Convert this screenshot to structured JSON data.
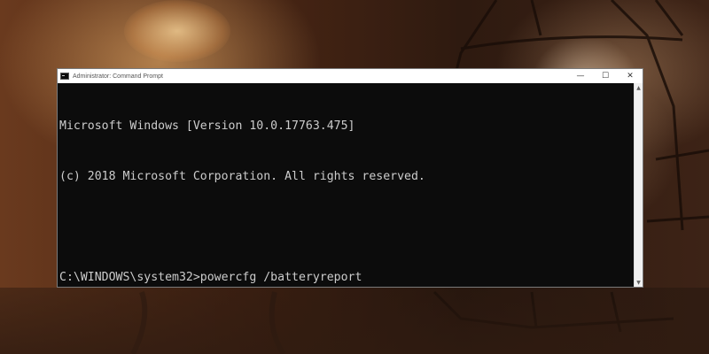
{
  "window": {
    "title": "Administrator: Command Prompt",
    "icon": "cmd-icon",
    "controls": {
      "minimize_glyph": "—",
      "maximize_glyph": "☐",
      "close_glyph": "✕"
    }
  },
  "console": {
    "lines": [
      "Microsoft Windows [Version 10.0.17763.475]",
      "(c) 2018 Microsoft Corporation. All rights reserved.",
      "",
      "C:\\WINDOWS\\system32>powercfg /batteryreport"
    ],
    "text_color": "#cccccc",
    "background_color": "#0c0c0c"
  },
  "scrollbar": {
    "up_glyph": "▲",
    "down_glyph": "▼"
  }
}
